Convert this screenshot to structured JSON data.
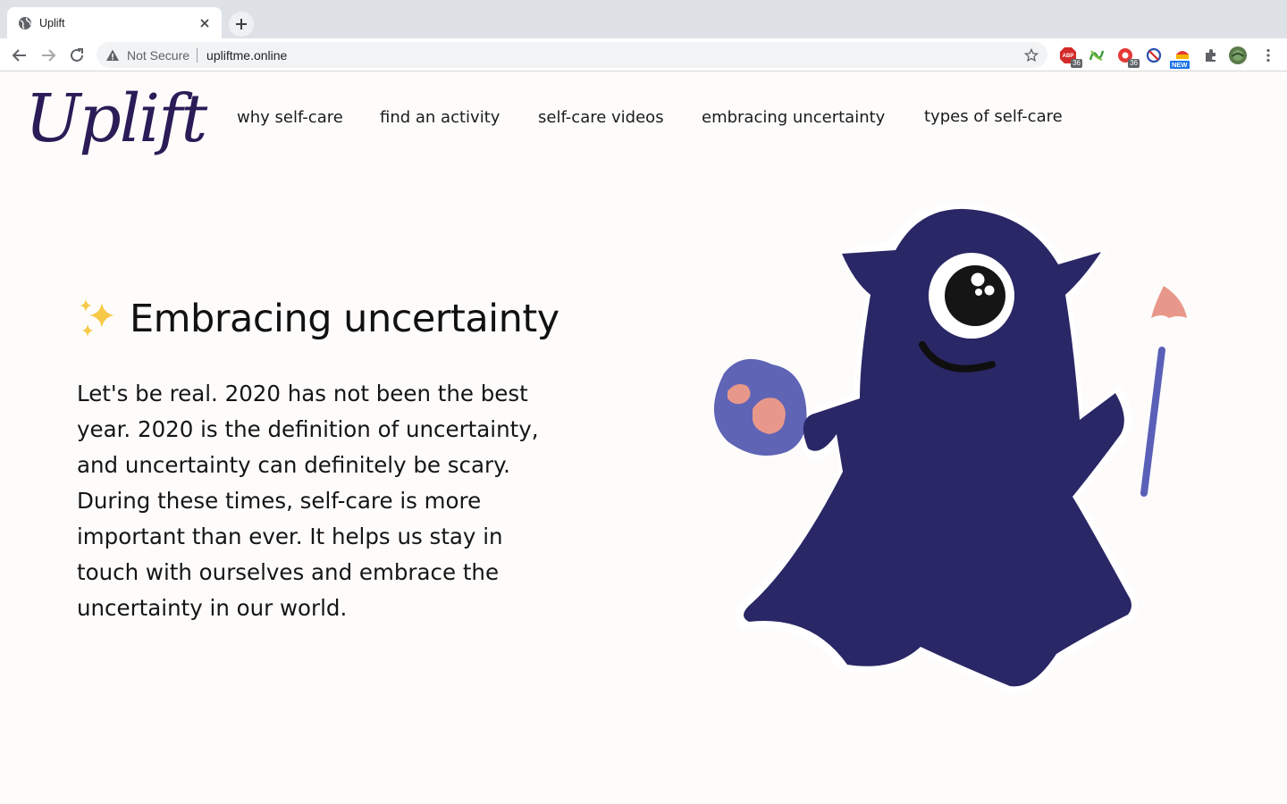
{
  "browser": {
    "tab": {
      "title": "Uplift",
      "favicon": "globe-icon",
      "close": "close-icon"
    },
    "new_tab": "plus-icon",
    "nav": {
      "back": "back-arrow-icon",
      "forward": "forward-arrow-icon",
      "reload": "reload-icon"
    },
    "omnibox": {
      "security_label": "Not Secure",
      "url": "upliftme.online",
      "bookmark": "star-icon"
    },
    "extensions": [
      {
        "name": "adblock-icon",
        "badge": "36"
      },
      {
        "name": "link-extension-icon",
        "badge": ""
      },
      {
        "name": "recorder-extension-icon",
        "badge": "36"
      },
      {
        "name": "block-extension-icon",
        "badge": ""
      },
      {
        "name": "new-extension-icon",
        "badge": "NEW"
      },
      {
        "name": "puzzle-icon",
        "badge": ""
      },
      {
        "name": "profile-avatar",
        "badge": ""
      },
      {
        "name": "kebab-menu-icon",
        "badge": ""
      }
    ],
    "colors": {
      "tabstrip": "#dee1e6",
      "toolbar": "#ffffff",
      "omnibox": "#f1f3f4"
    }
  },
  "site": {
    "logo": "Uplift",
    "nav": [
      {
        "label": "why self-care"
      },
      {
        "label": "find an activity"
      },
      {
        "label": "self-care videos"
      },
      {
        "label": "embracing uncertainty"
      },
      {
        "label": "types of self-care"
      }
    ],
    "hero": {
      "icon": "sparkles-icon",
      "title": "Embracing uncertainty",
      "body": "Let's be real. 2020 has not been the best year. 2020 is the definition of uncertainty, and uncertainty can definitely be scary. During these times, self-care is more important than ever. It helps us stay in touch with ourselves and embrace the uncertainty in our world."
    },
    "illustration": "monster-painter-illustration",
    "colors": {
      "brand": "#2b1c57",
      "monster": "#2a2766",
      "palette": "#5b63b8",
      "paint": "#e8988a",
      "background": "#fdfcfb"
    }
  }
}
